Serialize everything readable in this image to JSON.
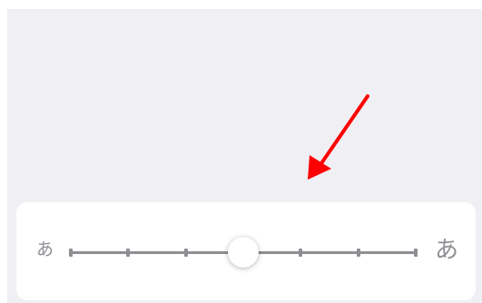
{
  "slider": {
    "min_glyph": "あ",
    "max_glyph": "あ",
    "steps": 7,
    "selected_step": 4
  },
  "annotation": {
    "arrow_color": "#ff0000"
  }
}
